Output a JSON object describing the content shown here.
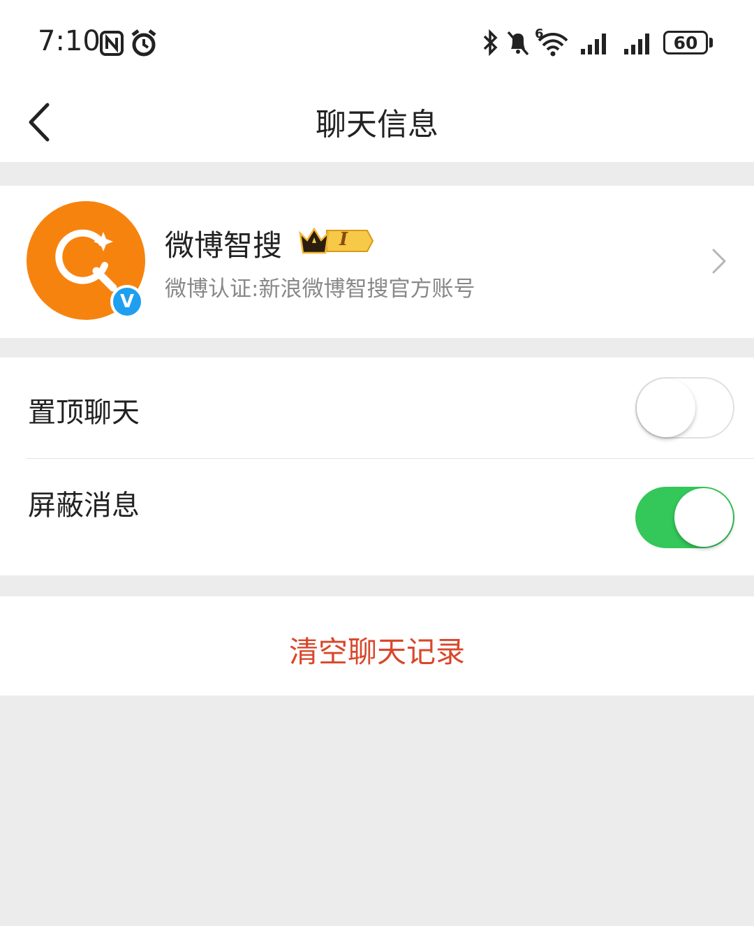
{
  "status_bar": {
    "time": "7:10",
    "battery": "60",
    "network_label": "6"
  },
  "header": {
    "title": "聊天信息"
  },
  "profile": {
    "name": "微博智搜",
    "verified_mark": "V",
    "vip_level": "I",
    "description": "微博认证:新浪微博智搜官方账号",
    "avatar_color": "#f7830f"
  },
  "settings": [
    {
      "label": "置顶聊天",
      "enabled": false
    },
    {
      "label": "屏蔽消息",
      "enabled": true
    }
  ],
  "actions": {
    "clear_history": "清空聊天记录"
  },
  "colors": {
    "accent_red": "#d9472b",
    "toggle_on": "#34c759",
    "verified_blue": "#1f9ff0"
  }
}
